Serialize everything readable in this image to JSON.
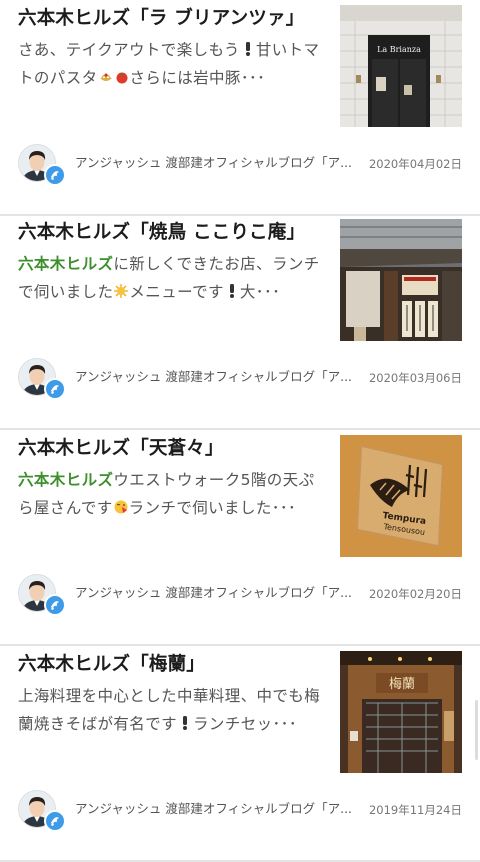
{
  "articles": [
    {
      "title": "六本木ヒルズ「ラ ブリアンツァ」",
      "desc_highlight": "",
      "desc_1": "さあ、テイクアウトで楽しもう",
      "desc_2": "甘いトマトのパスタ",
      "desc_3": "さらには岩中豚･･･",
      "thumb_sign": "La Brianza",
      "author": "アンジャッシュ 渡部建オフィシャルブログ「ア...",
      "date": "2020年04月02日"
    },
    {
      "title": "六本木ヒルズ「焼鳥 ここりこ庵」",
      "desc_highlight": "六本木ヒルズ",
      "desc_1": "に新しくできたお店、ランチで伺いました",
      "desc_2": "メニューです",
      "desc_3": "大･･･",
      "author": "アンジャッシュ 渡部建オフィシャルブログ「ア...",
      "date": "2020年03月06日"
    },
    {
      "title": "六本木ヒルズ「天蒼々」",
      "desc_highlight": "六本木ヒルズ",
      "desc_1": "ウエストウォーク5階の天ぷら屋さんです",
      "desc_2": "ランチで伺いました･･･",
      "thumb_sign_1": "Tempura",
      "thumb_sign_2": "Tensousou",
      "author": "アンジャッシュ 渡部建オフィシャルブログ「ア...",
      "date": "2020年02月20日"
    },
    {
      "title": "六本木ヒルズ「梅蘭」",
      "desc_highlight": "",
      "desc_1": "上海料理を中心とした中華料理、中でも梅蘭焼きそばが有名です",
      "desc_2": "ランチセッ･･･",
      "thumb_sign": "梅蘭",
      "author": "アンジャッシュ 渡部建オフィシャルブログ「ア...",
      "date": "2019年11月24日"
    }
  ],
  "colors": {
    "highlight": "#3e8f2e",
    "badge": "#3d9be9",
    "divider": "#e4e4e4"
  },
  "icons": [
    "exclamation-icon",
    "pasta-icon",
    "tomato-icon",
    "sun-icon",
    "kiss-face-icon",
    "avatar-photo",
    "ameba-badge-icon"
  ]
}
